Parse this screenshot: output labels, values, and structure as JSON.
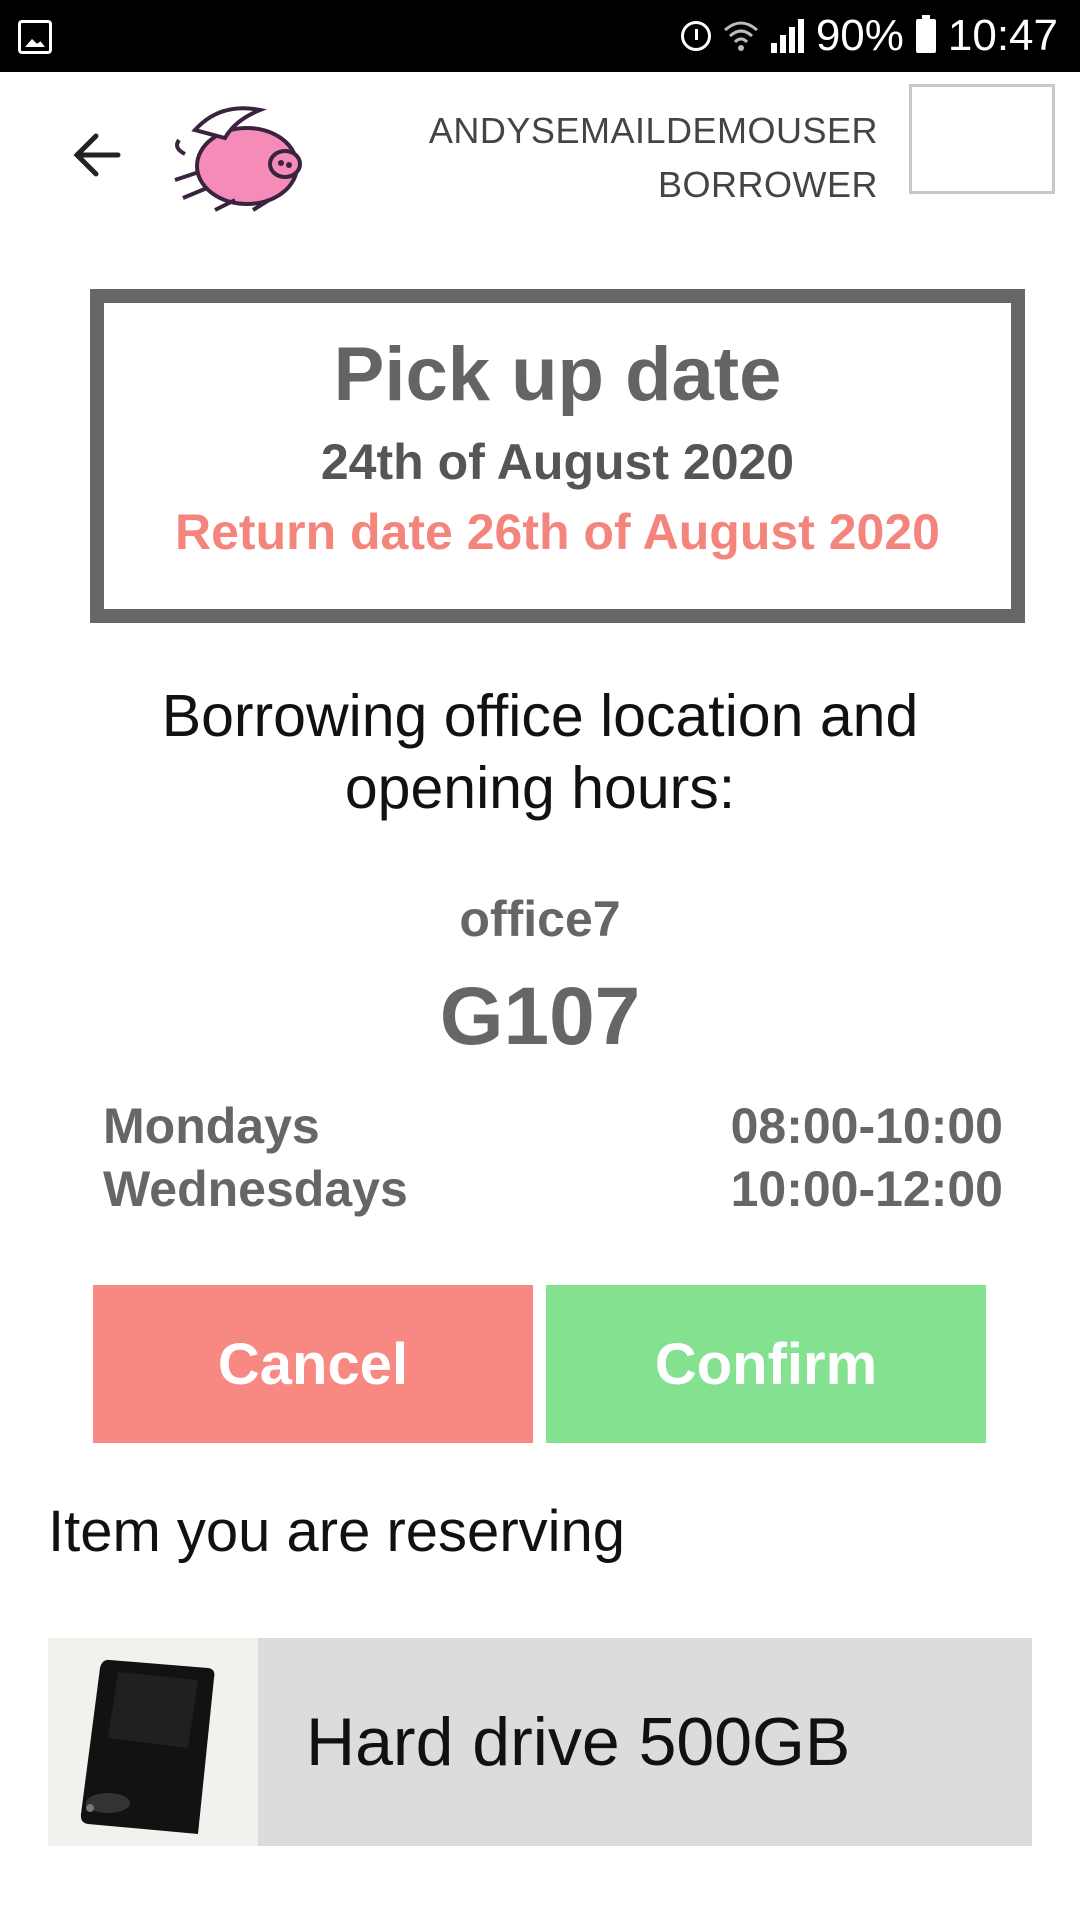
{
  "status_bar": {
    "battery_percent": "90%",
    "time": "10:47",
    "icons": [
      "gallery-icon",
      "alarm-icon",
      "wifi-icon",
      "signal-icon",
      "battery-icon"
    ]
  },
  "header": {
    "username": "ANDYSEMAILDEMOUSER",
    "role": "BORROWER",
    "icons": [
      "back-arrow-icon",
      "flying-pig-logo"
    ]
  },
  "reservation": {
    "title": "Pick up date",
    "pickup_date": "24th of August 2020",
    "return_date": "Return date 26th of August 2020"
  },
  "office": {
    "heading": "Borrowing office location and opening hours:",
    "name": "office7",
    "room": "G107",
    "hours": [
      {
        "day": "Mondays",
        "time": "08:00-10:00"
      },
      {
        "day": "Wednesdays",
        "time": "10:00-12:00"
      }
    ]
  },
  "actions": {
    "cancel_label": "Cancel",
    "confirm_label": "Confirm"
  },
  "item": {
    "heading": "Item you are reserving",
    "name": "Hard drive 500GB"
  },
  "colors": {
    "cancel": "#f78882",
    "confirm": "#84e190",
    "return_date": "#f4857d",
    "box_border": "#666666"
  }
}
